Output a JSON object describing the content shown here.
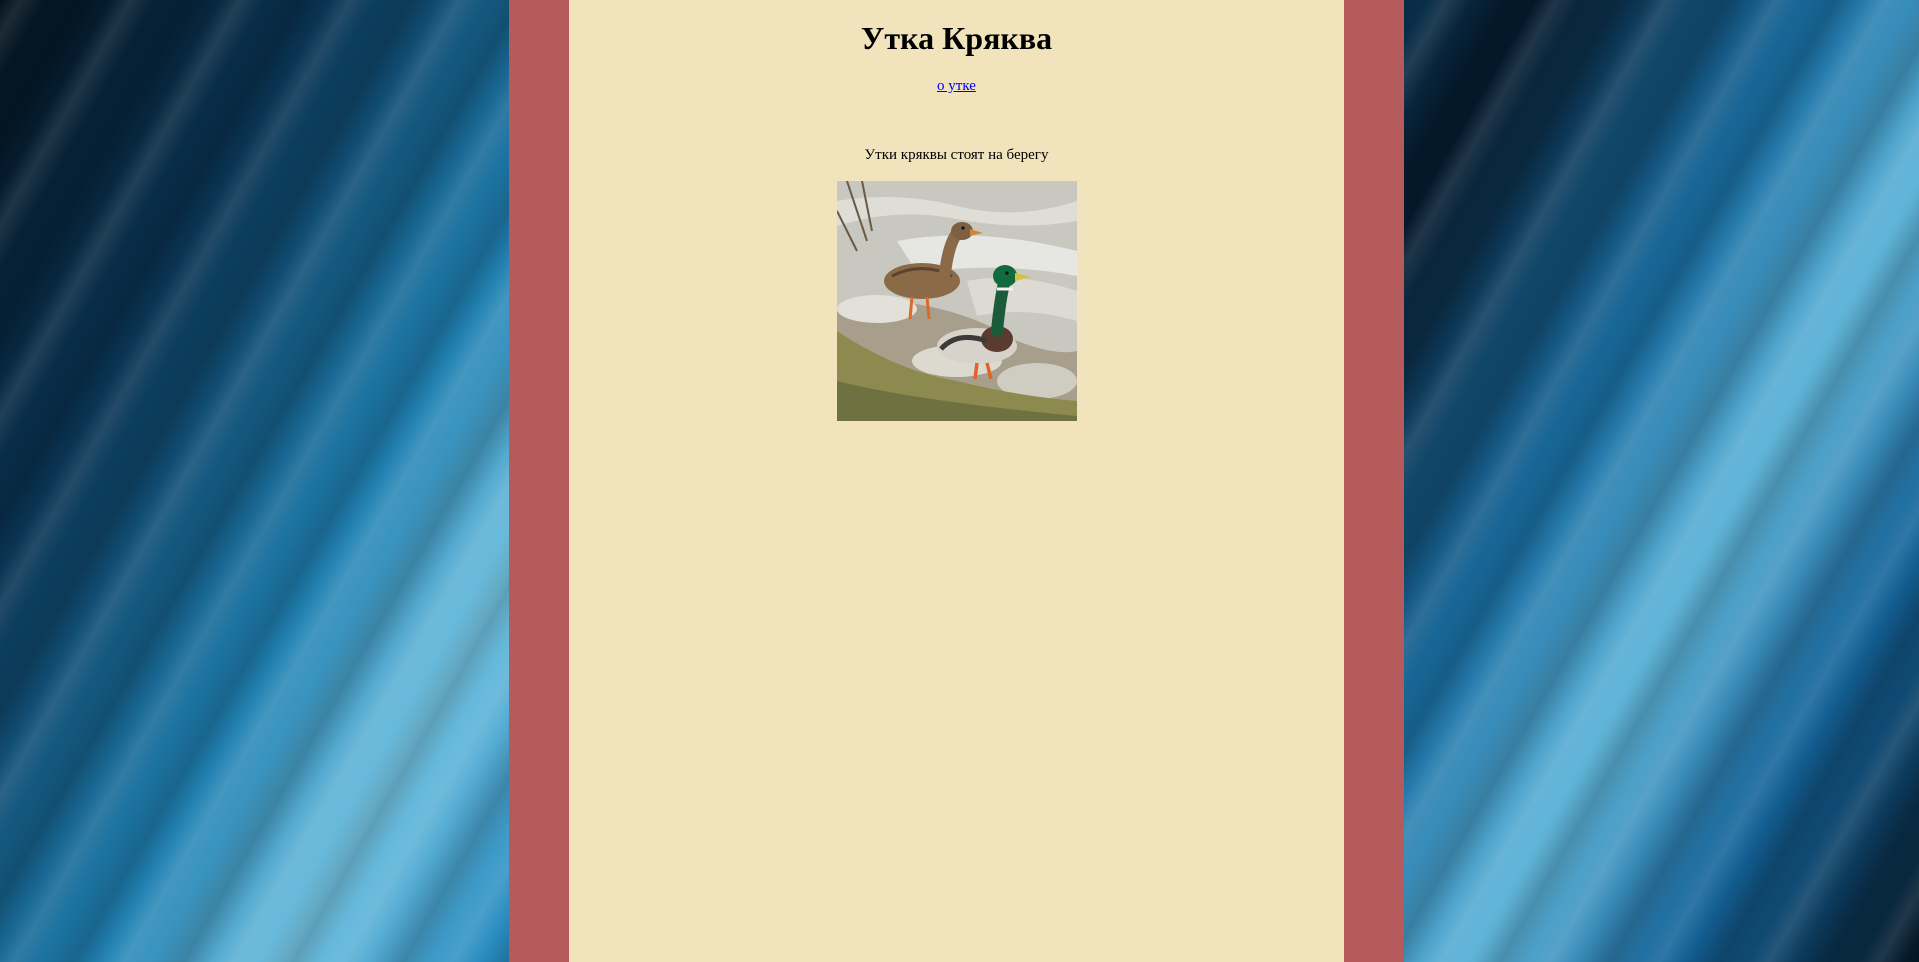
{
  "page": {
    "title": "Утка Кряква",
    "about_link_label": "о утке",
    "caption": "Утки кряквы стоят на берегу"
  },
  "image": {
    "subject": "two mallard ducks standing on a rocky shore by water"
  },
  "colors": {
    "frame": "#b55b5b",
    "panel": "#f1e4bd",
    "link": "#0000ee"
  }
}
